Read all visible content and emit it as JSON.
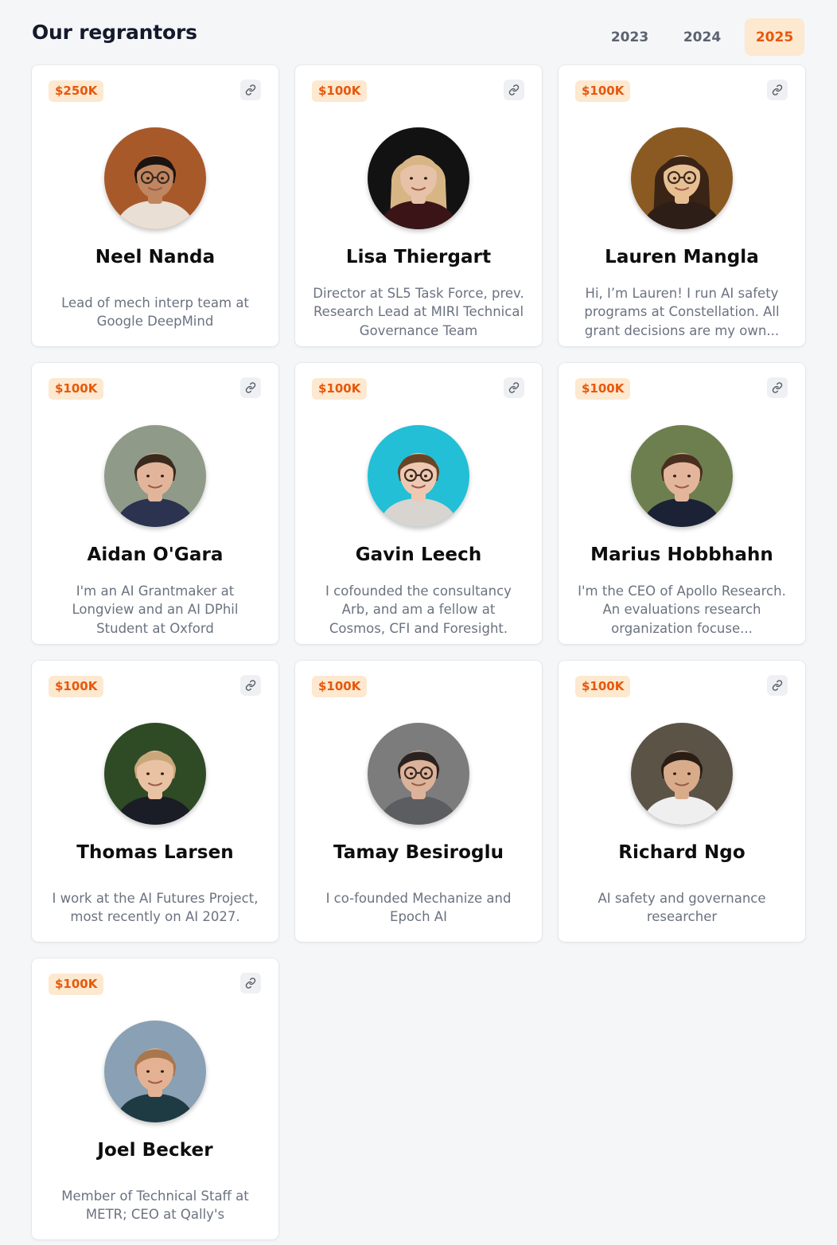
{
  "header": {
    "title": "Our regrantors",
    "years": [
      {
        "label": "2023",
        "active": false
      },
      {
        "label": "2024",
        "active": false
      },
      {
        "label": "2025",
        "active": true
      }
    ]
  },
  "colors": {
    "accent": "#e7580b",
    "accent_bg": "#fde8d0",
    "page_bg": "#f5f6f8"
  },
  "regrantors": [
    {
      "amount": "$250K",
      "name": "Neel Nanda",
      "bio": "Lead of mech interp team at Google DeepMind",
      "has_link": true,
      "icon": "link-icon",
      "avatar": {
        "bg": "#a8592a",
        "skin": "#c08660",
        "hair": "#1d1410",
        "shirt": "#e9dfd5",
        "glasses": true
      }
    },
    {
      "amount": "$100K",
      "name": "Lisa Thiergart",
      "bio": "Director at SL5 Task Force, prev. Research Lead at MIRI Technical Governance Team",
      "has_link": true,
      "icon": "link-icon",
      "avatar": {
        "bg": "#121212",
        "skin": "#e7c2a8",
        "hair": "#d7b585",
        "shirt": "#3b1418",
        "glasses": false
      }
    },
    {
      "amount": "$100K",
      "name": "Lauren Mangla",
      "bio": "Hi, I’m Lauren! I run AI safety programs at Constellation. All grant decisions are my own...",
      "has_link": true,
      "icon": "link-icon",
      "avatar": {
        "bg": "#8a5a22",
        "skin": "#e8bf92",
        "hair": "#3a2416",
        "shirt": "#2d1e18",
        "glasses": true
      }
    },
    {
      "amount": "$100K",
      "name": "Aidan O'Gara",
      "bio": "I'm an AI Grantmaker at Longview and an AI DPhil Student at Oxford",
      "has_link": true,
      "icon": "link-icon",
      "avatar": {
        "bg": "#8f9a88",
        "skin": "#e2b59a",
        "hair": "#3a2a1e",
        "shirt": "#2b3350",
        "glasses": false
      }
    },
    {
      "amount": "$100K",
      "name": "Gavin Leech",
      "bio": "I cofounded the consultancy Arb, and am a fellow at Cosmos, CFI and Foresight.",
      "has_link": true,
      "icon": "link-icon",
      "avatar": {
        "bg": "#22bfd6",
        "skin": "#efc8b2",
        "hair": "#6a4426",
        "shirt": "#d8d4cf",
        "glasses": true
      }
    },
    {
      "amount": "$100K",
      "name": "Marius Hobbhahn",
      "bio": "I'm the CEO of Apollo Research. An evaluations research organization focuse...",
      "has_link": true,
      "icon": "link-icon",
      "avatar": {
        "bg": "#6e7f4f",
        "skin": "#e3b69c",
        "hair": "#4a2e1f",
        "shirt": "#1b2236",
        "glasses": false
      }
    },
    {
      "amount": "$100K",
      "name": "Thomas Larsen",
      "bio": "I work at the AI Futures Project, most recently on AI 2027.",
      "has_link": true,
      "icon": "link-icon",
      "avatar": {
        "bg": "#2f4b25",
        "skin": "#e9c2a3",
        "hair": "#c9a77a",
        "shirt": "#1b1d26",
        "glasses": false
      }
    },
    {
      "amount": "$100K",
      "name": "Tamay Besiroglu",
      "bio": "I co-founded Mechanize and Epoch AI",
      "has_link": false,
      "icon": "",
      "avatar": {
        "bg": "#7c7c7c",
        "skin": "#dcb39a",
        "hair": "#2a2220",
        "shirt": "#5c5d61",
        "glasses": true
      }
    },
    {
      "amount": "$100K",
      "name": "Richard Ngo",
      "bio": "AI safety and governance researcher",
      "has_link": true,
      "icon": "link-icon",
      "avatar": {
        "bg": "#5b5346",
        "skin": "#d8ac8a",
        "hair": "#2a1d16",
        "shirt": "#efefef",
        "glasses": false
      }
    },
    {
      "amount": "$100K",
      "name": "Joel Becker",
      "bio": "Member of Technical Staff at METR; CEO at Qally's",
      "has_link": true,
      "icon": "link-icon",
      "avatar": {
        "bg": "#8aa0b4",
        "skin": "#e4b293",
        "hair": "#a8774e",
        "shirt": "#1e3b44",
        "glasses": false
      }
    }
  ]
}
